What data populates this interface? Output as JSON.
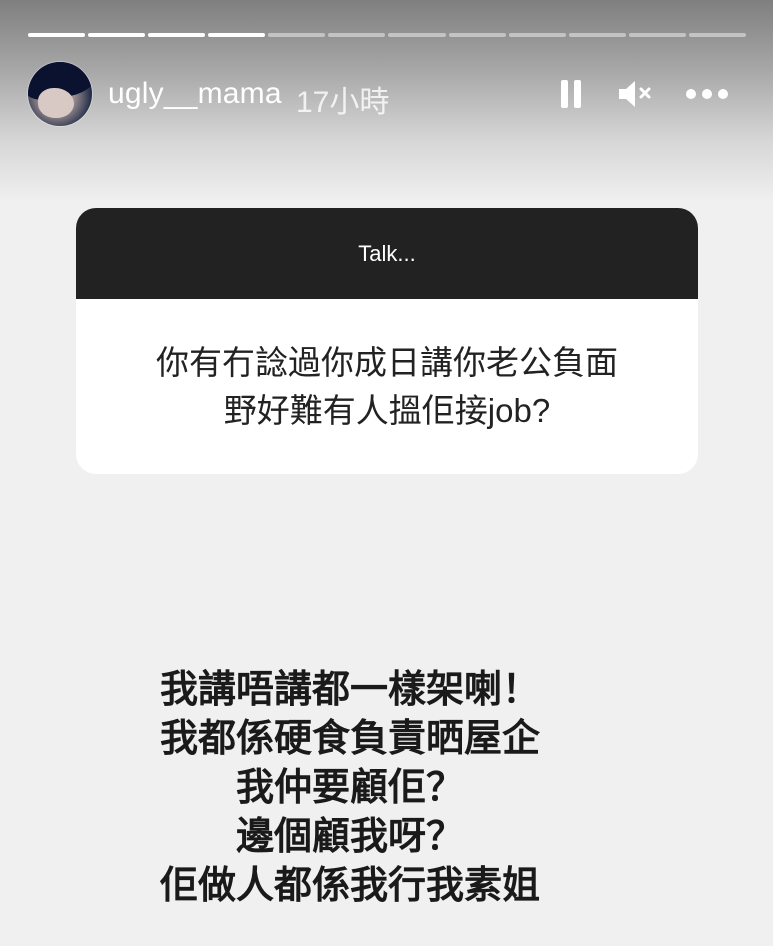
{
  "story": {
    "progress": {
      "segments_total": 12,
      "segments_completed": 4
    },
    "header": {
      "username": "ugly__mama",
      "time_ago": "17小時"
    },
    "question_card": {
      "header_text": "Talk...",
      "question_lines": [
        "你有冇諗過你成日講你老公負面",
        "野好難有人搵佢接job?"
      ]
    },
    "answer_lines": [
      "我講唔講都一樣架喇！",
      "我都係硬食負責晒屋企",
      "我仲要顧佢？",
      "邊個顧我呀？",
      "佢做人都係我行我素姐"
    ],
    "icons": {
      "pause": "pause-icon",
      "mute": "speaker-muted-icon",
      "more": "more-options-icon"
    },
    "colors": {
      "card_header": "#222222",
      "background": "#f0f0f0"
    }
  }
}
